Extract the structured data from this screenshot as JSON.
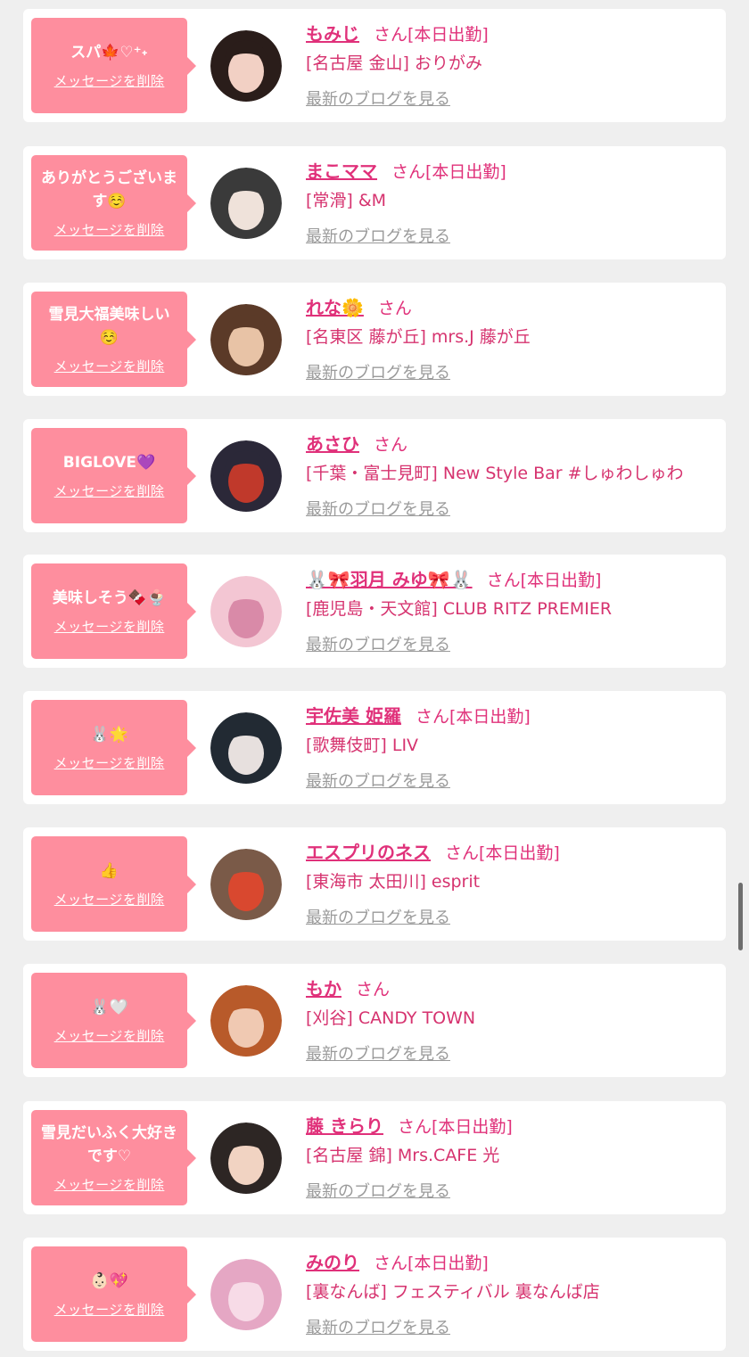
{
  "delete_label": "メッセージを削除",
  "blog_label": "最新のブログを見る",
  "san": "さん",
  "colors": {
    "bubble": "#fe8e9e",
    "name": "#e0317a",
    "background": "#efefef"
  },
  "items": [
    {
      "message": "スパ🍁♡⁺˖",
      "name": "もみじ",
      "status": "[本日出勤]",
      "shop": "[名古屋 金山] おりがみ",
      "avatar_colors": [
        "#2a1d1a",
        "#f2d0c4"
      ]
    },
    {
      "message": "ありがとうございます☺️",
      "name": "まこママ",
      "status": "[本日出勤]",
      "shop": "[常滑] &M",
      "avatar_colors": [
        "#3a3a3a",
        "#efe2da"
      ]
    },
    {
      "message": "雪見大福美味しい☺️",
      "name": "れな🌼",
      "status": "",
      "shop": "[名東区 藤が丘] mrs.J 藤が丘",
      "avatar_colors": [
        "#5b3a28",
        "#e8c3a6"
      ]
    },
    {
      "message": "BIGLOVE💜",
      "name": "あさひ",
      "status": "",
      "shop": "[千葉・富士見町] New Style Bar #しゅわしゅわ",
      "avatar_colors": [
        "#2b2838",
        "#c0392b"
      ]
    },
    {
      "message": "美味しそう🍫🍨",
      "name": "🐰🎀羽月 みゆ🎀🐰",
      "status": "[本日出勤]",
      "shop": "[鹿児島・天文館] CLUB RITZ PREMIER",
      "avatar_colors": [
        "#f3c6d3",
        "#d98aa8"
      ]
    },
    {
      "message": "🐰🌟",
      "name": "宇佐美 姫羅",
      "status": "[本日出勤]",
      "shop": "[歌舞伎町] LIV",
      "avatar_colors": [
        "#222a33",
        "#e7e0de"
      ]
    },
    {
      "message": "👍",
      "name": "エスプリのネス",
      "status": "[本日出勤]",
      "shop": "[東海市 太田川] esprit",
      "avatar_colors": [
        "#7a5a48",
        "#d9482f"
      ]
    },
    {
      "message": "🐰🤍",
      "name": "もか",
      "status": "",
      "shop": "[刈谷] CANDY TOWN",
      "avatar_colors": [
        "#b85a2a",
        "#f0c9b2"
      ]
    },
    {
      "message": "雪見だいふく大好きです♡",
      "name": "藤 きらり",
      "status": "[本日出勤]",
      "shop": "[名古屋 錦] Mrs.CAFE 光",
      "avatar_colors": [
        "#2d2624",
        "#f1d3c2"
      ]
    },
    {
      "message": "👶🏻💖",
      "name": "みのり",
      "status": "[本日出勤]",
      "shop": "[裏なんば] フェスティバル 裏なんば店",
      "avatar_colors": [
        "#e5a7c4",
        "#f7dbe7"
      ]
    }
  ]
}
